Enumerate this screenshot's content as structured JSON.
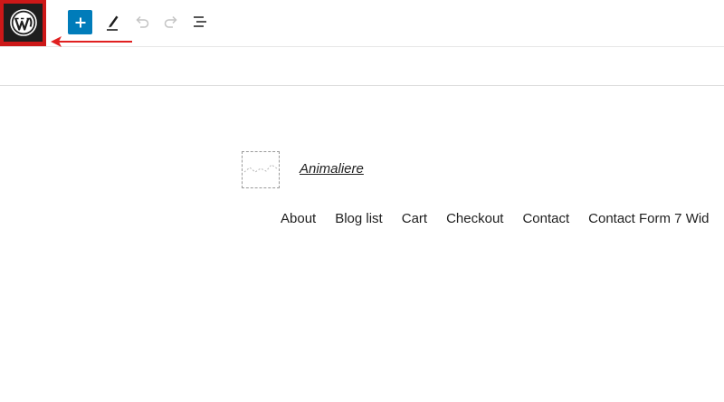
{
  "toolbar": {
    "logo_icon": "wordpress-logo-icon",
    "add_icon": "plus-icon",
    "tools_icon": "pencil-icon",
    "undo_icon": "undo-icon",
    "redo_icon": "redo-icon",
    "list_view_icon": "list-view-icon",
    "accent_color": "#007cba",
    "highlight_color": "#cc1818"
  },
  "site": {
    "title": "Animaliere"
  },
  "nav": {
    "items": [
      {
        "label": "About"
      },
      {
        "label": "Blog list"
      },
      {
        "label": "Cart"
      },
      {
        "label": "Checkout"
      },
      {
        "label": "Contact"
      },
      {
        "label": "Contact Form 7 Wid"
      }
    ]
  }
}
